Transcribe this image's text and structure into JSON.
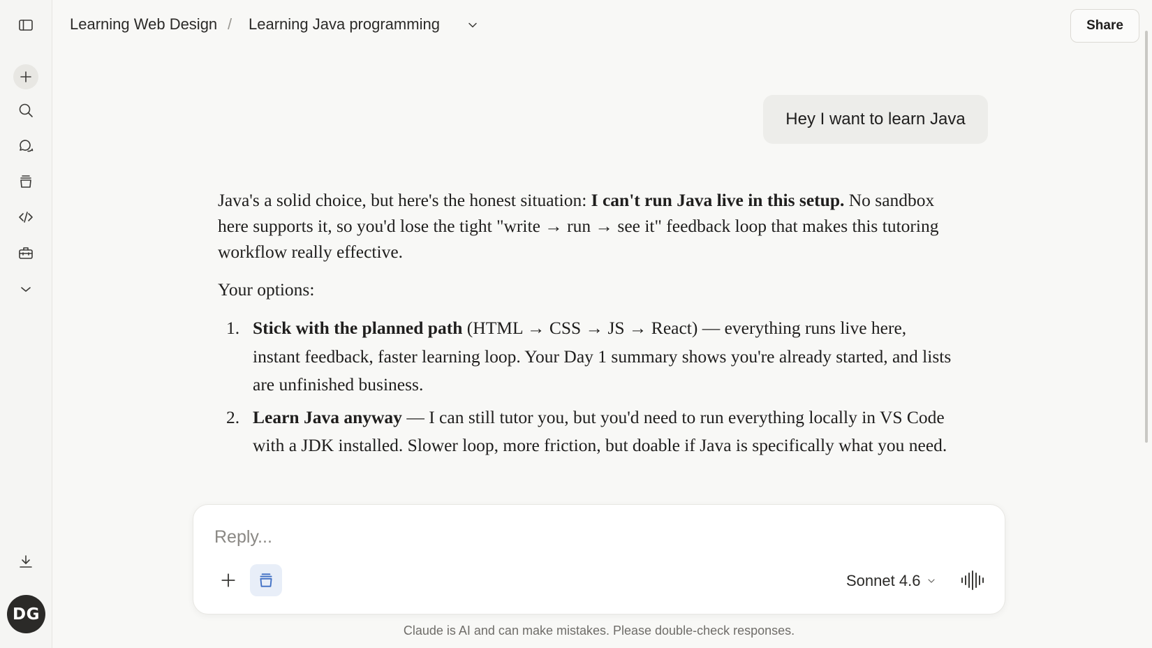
{
  "breadcrumb": {
    "project": "Learning Web Design",
    "separator": "/",
    "chat": "Learning Java programming"
  },
  "header": {
    "share_label": "Share"
  },
  "sidebar": {
    "icons": [
      "sidebar-toggle-icon",
      "new-chat-icon",
      "search-icon",
      "chats-icon",
      "projects-icon",
      "code-icon",
      "tools-icon",
      "chevron-down-icon",
      "download-icon"
    ],
    "avatar_initials": "DG"
  },
  "conversation": {
    "user_message": "Hey I want to learn Java",
    "assistant": {
      "p1_a": "Java's a solid choice, but here's the honest situation: ",
      "p1_b": "I can't run Java live in this setup.",
      "p1_c": " No sandbox here supports it, so you'd lose the tight \"write → run → see it\" feedback loop that makes this tutoring workflow really effective.",
      "p2": "Your options:",
      "items": [
        {
          "num": "1.",
          "bold": "Stick with the planned path",
          "text": " (HTML → CSS → JS → React) — everything runs live here, instant feedback, faster learning loop. Your Day 1 summary shows you're already started, and lists are unfinished business."
        },
        {
          "num": "2.",
          "bold": "Learn Java anyway",
          "text": " — I can still tutor you, but you'd need to run everything locally in VS Code with a JDK installed. Slower loop, more friction, but doable if Java is specifically what you need."
        }
      ]
    }
  },
  "composer": {
    "placeholder": "Reply...",
    "value": "",
    "model": "Sonnet 4.6",
    "accent_color": "#3f6fc4"
  },
  "footer": {
    "disclaimer": "Claude is AI and can make mistakes. Please double-check responses."
  }
}
